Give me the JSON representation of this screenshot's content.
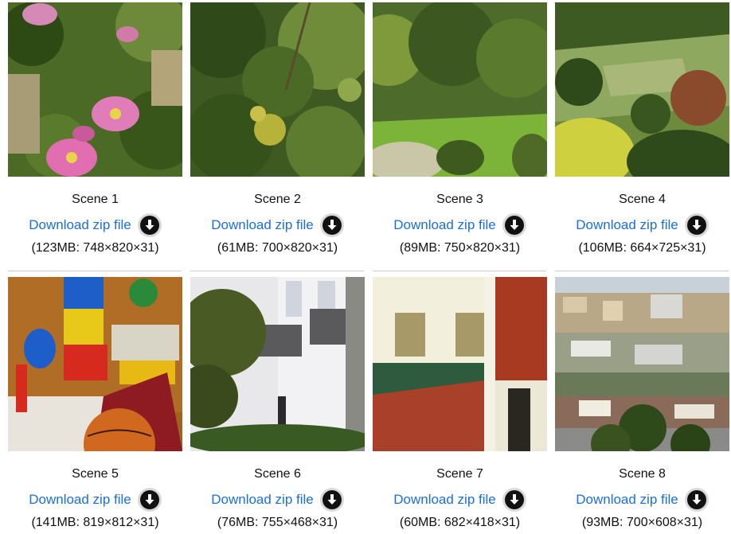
{
  "scenes": [
    {
      "title": "Scene 1",
      "link": "Download zip file",
      "meta": "(123MB: 748×820×31)",
      "thumb_icon": "rose-flowers-image"
    },
    {
      "title": "Scene 2",
      "link": "Download zip file",
      "meta": "(61MB: 700×820×31)",
      "thumb_icon": "forest-foliage-image"
    },
    {
      "title": "Scene 3",
      "link": "Download zip file",
      "meta": "(89MB: 750×820×31)",
      "thumb_icon": "meadow-trees-image"
    },
    {
      "title": "Scene 4",
      "link": "Download zip file",
      "meta": "(106MB: 664×725×31)",
      "thumb_icon": "hillside-landscape-image"
    },
    {
      "title": "Scene 5",
      "link": "Download zip file",
      "meta": "(141MB: 819×812×31)",
      "thumb_icon": "toys-basketball-image"
    },
    {
      "title": "Scene 6",
      "link": "Download zip file",
      "meta": "(76MB: 755×468×31)",
      "thumb_icon": "white-building-balcony-image"
    },
    {
      "title": "Scene 7",
      "link": "Download zip file",
      "meta": "(60MB: 682×418×31)",
      "thumb_icon": "modern-building-brick-image"
    },
    {
      "title": "Scene 8",
      "link": "Download zip file",
      "meta": "(93MB: 700×608×31)",
      "thumb_icon": "city-view-image"
    }
  ],
  "colors": {
    "link": "#1a6fe0",
    "text": "#111111",
    "icon_ring": "#d9d9d9",
    "icon_fill": "#111111"
  },
  "download_icon": "download-arrow-icon"
}
